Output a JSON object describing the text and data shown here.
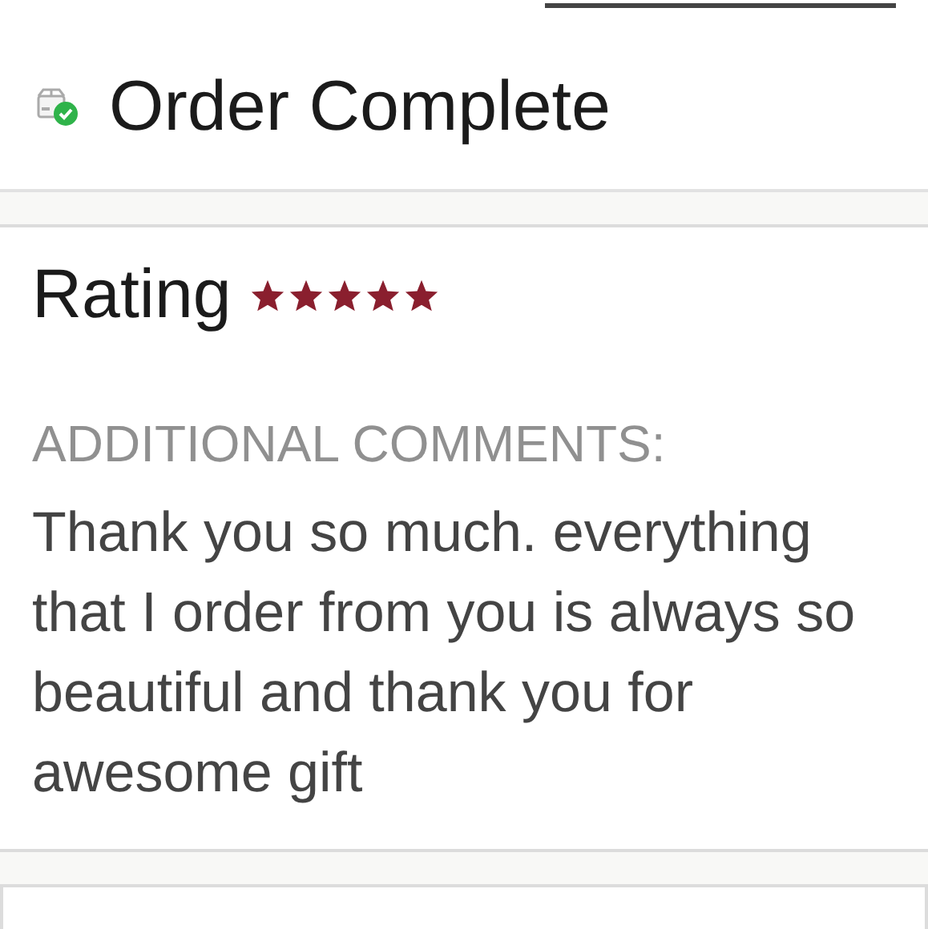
{
  "header": {
    "status": "Order Complete"
  },
  "review": {
    "label": "Rating",
    "stars": 5,
    "comments_label": "ADDITIONAL COMMENTS:",
    "comment": "Thank you so much. everything that I order from you is always so beautiful and thank you for awesome gift"
  }
}
